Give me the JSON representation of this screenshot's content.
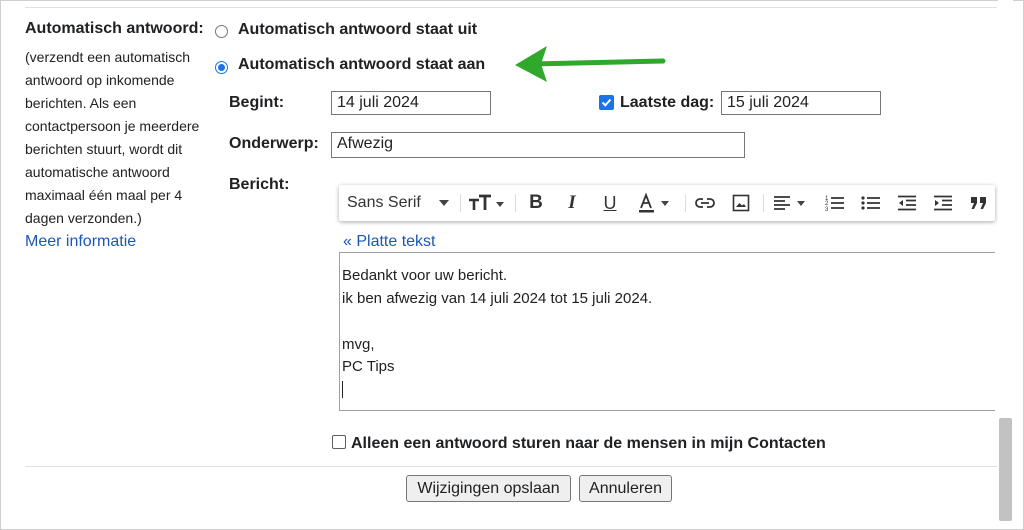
{
  "vacation": {
    "section_label": "Automatisch antwoord:",
    "description": "(verzendt een automatisch antwoord op inkomende berichten. Als een contactpersoon je meerdere berichten stuurt, wordt dit automatische antwoord maximaal één maal per 4 dagen verzonden.)",
    "more_info": "Meer informatie",
    "option_off": "Automatisch antwoord staat uit",
    "option_on": "Automatisch antwoord staat aan",
    "selected": "on"
  },
  "fields": {
    "start_label": "Begint:",
    "start_value": "14 juli 2024",
    "last_day_label": "Laatste dag:",
    "last_day_checked": true,
    "last_day_value": "15 juli 2024",
    "subject_label": "Onderwerp:",
    "subject_value": "Afwezig",
    "message_label": "Bericht:"
  },
  "toolbar": {
    "font": "Sans Serif",
    "buttons": [
      "font-size",
      "bold",
      "italic",
      "underline",
      "text-color",
      "link",
      "image",
      "align",
      "numbered-list",
      "bulleted-list",
      "indent-less",
      "indent-more",
      "quote"
    ]
  },
  "editor": {
    "plain_text_link": "« Platte tekst",
    "lines": [
      "Bedankt voor uw bericht.",
      "ik ben afwezig van 14 juli 2024 tot 15 juli 2024.",
      "",
      "mvg,",
      "PC Tips"
    ]
  },
  "contacts_only": {
    "label": "Alleen een antwoord sturen naar de mensen in mijn Contacten",
    "checked": false
  },
  "actions": {
    "save": "Wijzigingen opslaan",
    "cancel": "Annuleren"
  },
  "colors": {
    "accent": "#1a73e8",
    "link": "#1a57b6",
    "arrow": "#2fa82b"
  }
}
